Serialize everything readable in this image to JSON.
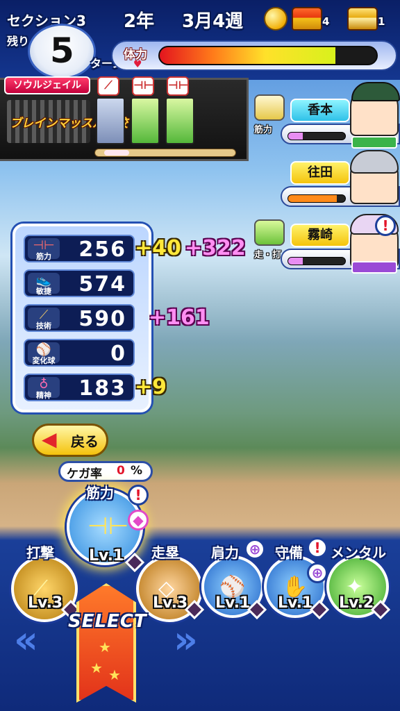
{
  "header": {
    "section": "セクション3",
    "remaining_label": "残り",
    "turns_left": "5",
    "turn_unit": "ターン",
    "year": "2年",
    "week": "3月4週",
    "stamina_label": "体力",
    "stamina_level": 0.81
  },
  "currency": {
    "chest_red_count": "4",
    "chest_gold_count": "1"
  },
  "team": {
    "name": "ソウルジェイル",
    "logo_text": "ブレインマッスル高校"
  },
  "teammates": [
    {
      "name": "香本",
      "training_label": "筋力",
      "bar_level": 0.25,
      "bar_color": "#e88ef2"
    },
    {
      "name": "往田",
      "bar_level": 0.85,
      "bar_color": "#ff8a1a"
    },
    {
      "name": "霧崎",
      "training_label": "走・打",
      "bar_level": 0.25,
      "bar_color": "#e88ef2",
      "alert": "!"
    }
  ],
  "stats": [
    {
      "name": "筋力",
      "icon": "dumbbell-icon",
      "value": "256",
      "bonus_yellow": "+40",
      "bonus_pink": "+322"
    },
    {
      "name": "敏捷",
      "icon": "shoe-icon",
      "value": "574"
    },
    {
      "name": "技術",
      "icon": "bat-icon",
      "value": "590",
      "bonus_pink": "+161"
    },
    {
      "name": "変化球",
      "icon": "ball-icon",
      "value": "0"
    },
    {
      "name": "精神",
      "icon": "spirit-icon",
      "value": "183",
      "bonus_yellow": "+9"
    }
  ],
  "back_button": "戻る",
  "injury": {
    "label": "ケガ率",
    "value": "0",
    "unit": "%"
  },
  "training_menu": [
    {
      "name": "筋力",
      "level": "Lv.1",
      "alert": "!"
    },
    {
      "name": "打撃",
      "level": "Lv.3"
    },
    {
      "name": "走塁",
      "level": "Lv.3"
    },
    {
      "name": "肩力",
      "level": "Lv.1"
    },
    {
      "name": "守備",
      "level": "Lv.1",
      "alert": "!"
    },
    {
      "name": "メンタル",
      "level": "Lv.2"
    }
  ],
  "select_label": "SELECT"
}
